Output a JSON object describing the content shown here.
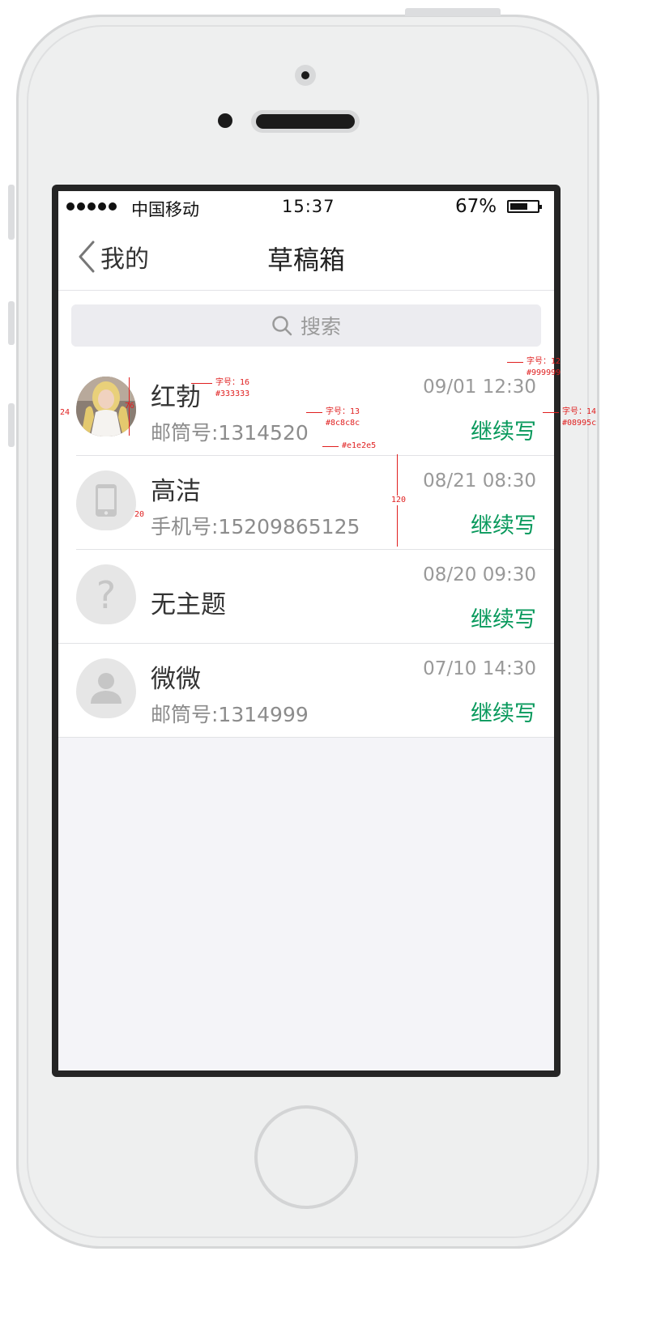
{
  "status_bar": {
    "carrier": "中国移动",
    "time": "15:37",
    "battery_percent": "67%",
    "battery_level": 0.67
  },
  "nav": {
    "back_label": "我的",
    "title": "草稿箱"
  },
  "search": {
    "label": "搜索"
  },
  "drafts": [
    {
      "name": "红勃",
      "subtitle": "邮筒号:1314520",
      "time": "09/01 12:30",
      "action": "继续写",
      "avatar": "photo-avatar"
    },
    {
      "name": "高洁",
      "subtitle": "手机号:15209865125",
      "time": "08/21 08:30",
      "action": "继续写",
      "avatar": "phone-icon"
    },
    {
      "name": "无主题",
      "subtitle": "",
      "time": "08/20 09:30",
      "action": "继续写",
      "avatar": "question-icon"
    },
    {
      "name": "微微",
      "subtitle": "邮筒号:1314999",
      "time": "07/10 14:30",
      "action": "继续写",
      "avatar": "user-icon"
    }
  ],
  "annotations": {
    "name_font": "字号：16",
    "name_color": "#333333",
    "sub_font": "字号：13",
    "sub_color": "#8c8c8c",
    "time_font": "字号：12",
    "time_color": "#999999",
    "action_font": "字号：14",
    "action_color": "#08995c",
    "divider_color": "#e1e2e5",
    "row_height": "120",
    "avatar_size": "76",
    "left_margin": "24",
    "avatar_gap": "20"
  },
  "colors": {
    "accent": "#08995c",
    "name_text": "#333333",
    "sub_text": "#8c8c8c",
    "time_text": "#999999",
    "divider": "#e1e2e5",
    "background": "#f4f4f8"
  }
}
